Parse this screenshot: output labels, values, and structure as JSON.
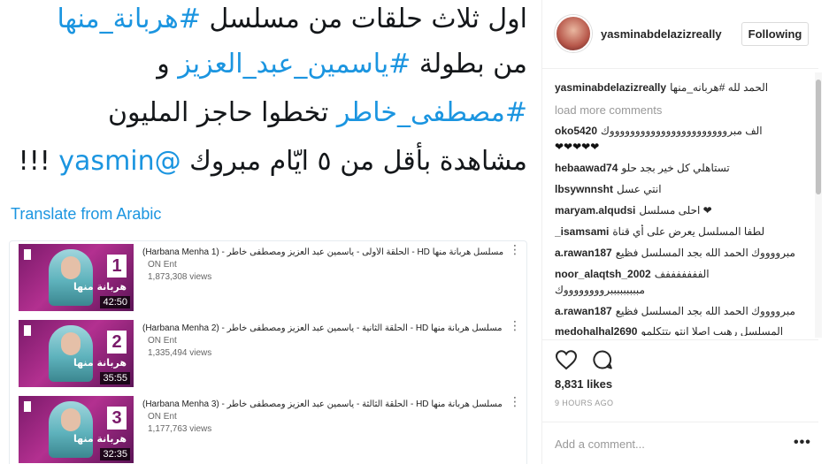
{
  "tweet": {
    "lines": [
      {
        "parts": [
          {
            "t": "اول ثلاث حلقات من مسلسل ",
            "tag": false
          },
          {
            "t": "#هربانة_منها",
            "tag": true
          }
        ]
      },
      {
        "parts": [
          {
            "t": "من بطولة ",
            "tag": false
          },
          {
            "t": "#ياسمين_عبد_العزيز",
            "tag": true
          },
          {
            "t": " و",
            "tag": false
          }
        ]
      },
      {
        "parts": [
          {
            "t": "#مصطفى_خاطر",
            "tag": true
          },
          {
            "t": " تخطوا حاجز المليون",
            "tag": false
          }
        ]
      },
      {
        "parts": [
          {
            "t": "مشاهدة بأقل من ٥ ايّام مبروك ",
            "tag": false
          },
          {
            "t": "@yasmin",
            "tag": true
          },
          {
            "t": " !!!",
            "tag": false
          }
        ]
      }
    ],
    "translate_label": "Translate from Arabic"
  },
  "videos": [
    {
      "title": "(Harbana Menha 1) - الحلقة الأولى - ياسمين عبد العزيز ومصطفى خاطر - HD مسلسل هربانة منها",
      "channel": "ON Ent",
      "views": "1,873,308 views",
      "duration": "42:50",
      "ep": "1",
      "more": "⋮"
    },
    {
      "title": "(Harbana Menha 2) - الحلقة الثانية - ياسمين عبد العزيز ومصطفى خاطر - HD مسلسل هربانة منها",
      "channel": "ON Ent",
      "views": "1,335,494 views",
      "duration": "35:55",
      "ep": "2",
      "more": "⋮"
    },
    {
      "title": "(Harbana Menha 3) - الحلقة الثالثة - ياسمين عبد العزيز ومصطفى خاطر - HD مسلسل هربانة منها",
      "channel": "ON Ent",
      "views": "1,177,763 views",
      "duration": "32:35",
      "ep": "3",
      "more": "⋮"
    }
  ],
  "thumb_caption": "هربانة منها",
  "header": {
    "username": "yasminabdelazizreally",
    "follow_label": "Following"
  },
  "comments": [
    {
      "user": "yasminabdelazizreally",
      "text": "الحمد لله #هربانه_منها"
    },
    {
      "user": "oko5420",
      "text": "الف مبروووووووووووووووووووووووك"
    },
    {
      "user": "",
      "text": "❤❤❤❤❤"
    },
    {
      "user": "hebaawad74",
      "text": "تستاهلي كل خير بجد حلو"
    },
    {
      "user": "lbsywnnsht",
      "text": "انتي عسل"
    },
    {
      "user": "maryam.alqudsi",
      "text": "احلى مسلسل ❤"
    },
    {
      "user": "_isamsami",
      "text": "لطفا المسلسل يعرض على أي قناة"
    },
    {
      "user": "a.rawan187",
      "text": "مبرووووك الحمد الله بجد المسلسل فظيع"
    },
    {
      "user": "noor_alaqtsh_2002",
      "text": "الفففففففف"
    },
    {
      "user": "",
      "text": "مبببببببببرووووووووك"
    },
    {
      "user": "a.rawan187",
      "text": "مبرووووك الحمد الله بجد المسلسل فظيع"
    },
    {
      "user": "medohalhal2690",
      "text": "المسلسل رهيب اصلا انتو بتتكلمو"
    }
  ],
  "load_more": "load more comments",
  "likes": "8,831 likes",
  "time_ago": "9 HOURS AGO",
  "add_comment_placeholder": "Add a comment...",
  "more_options": "•••"
}
